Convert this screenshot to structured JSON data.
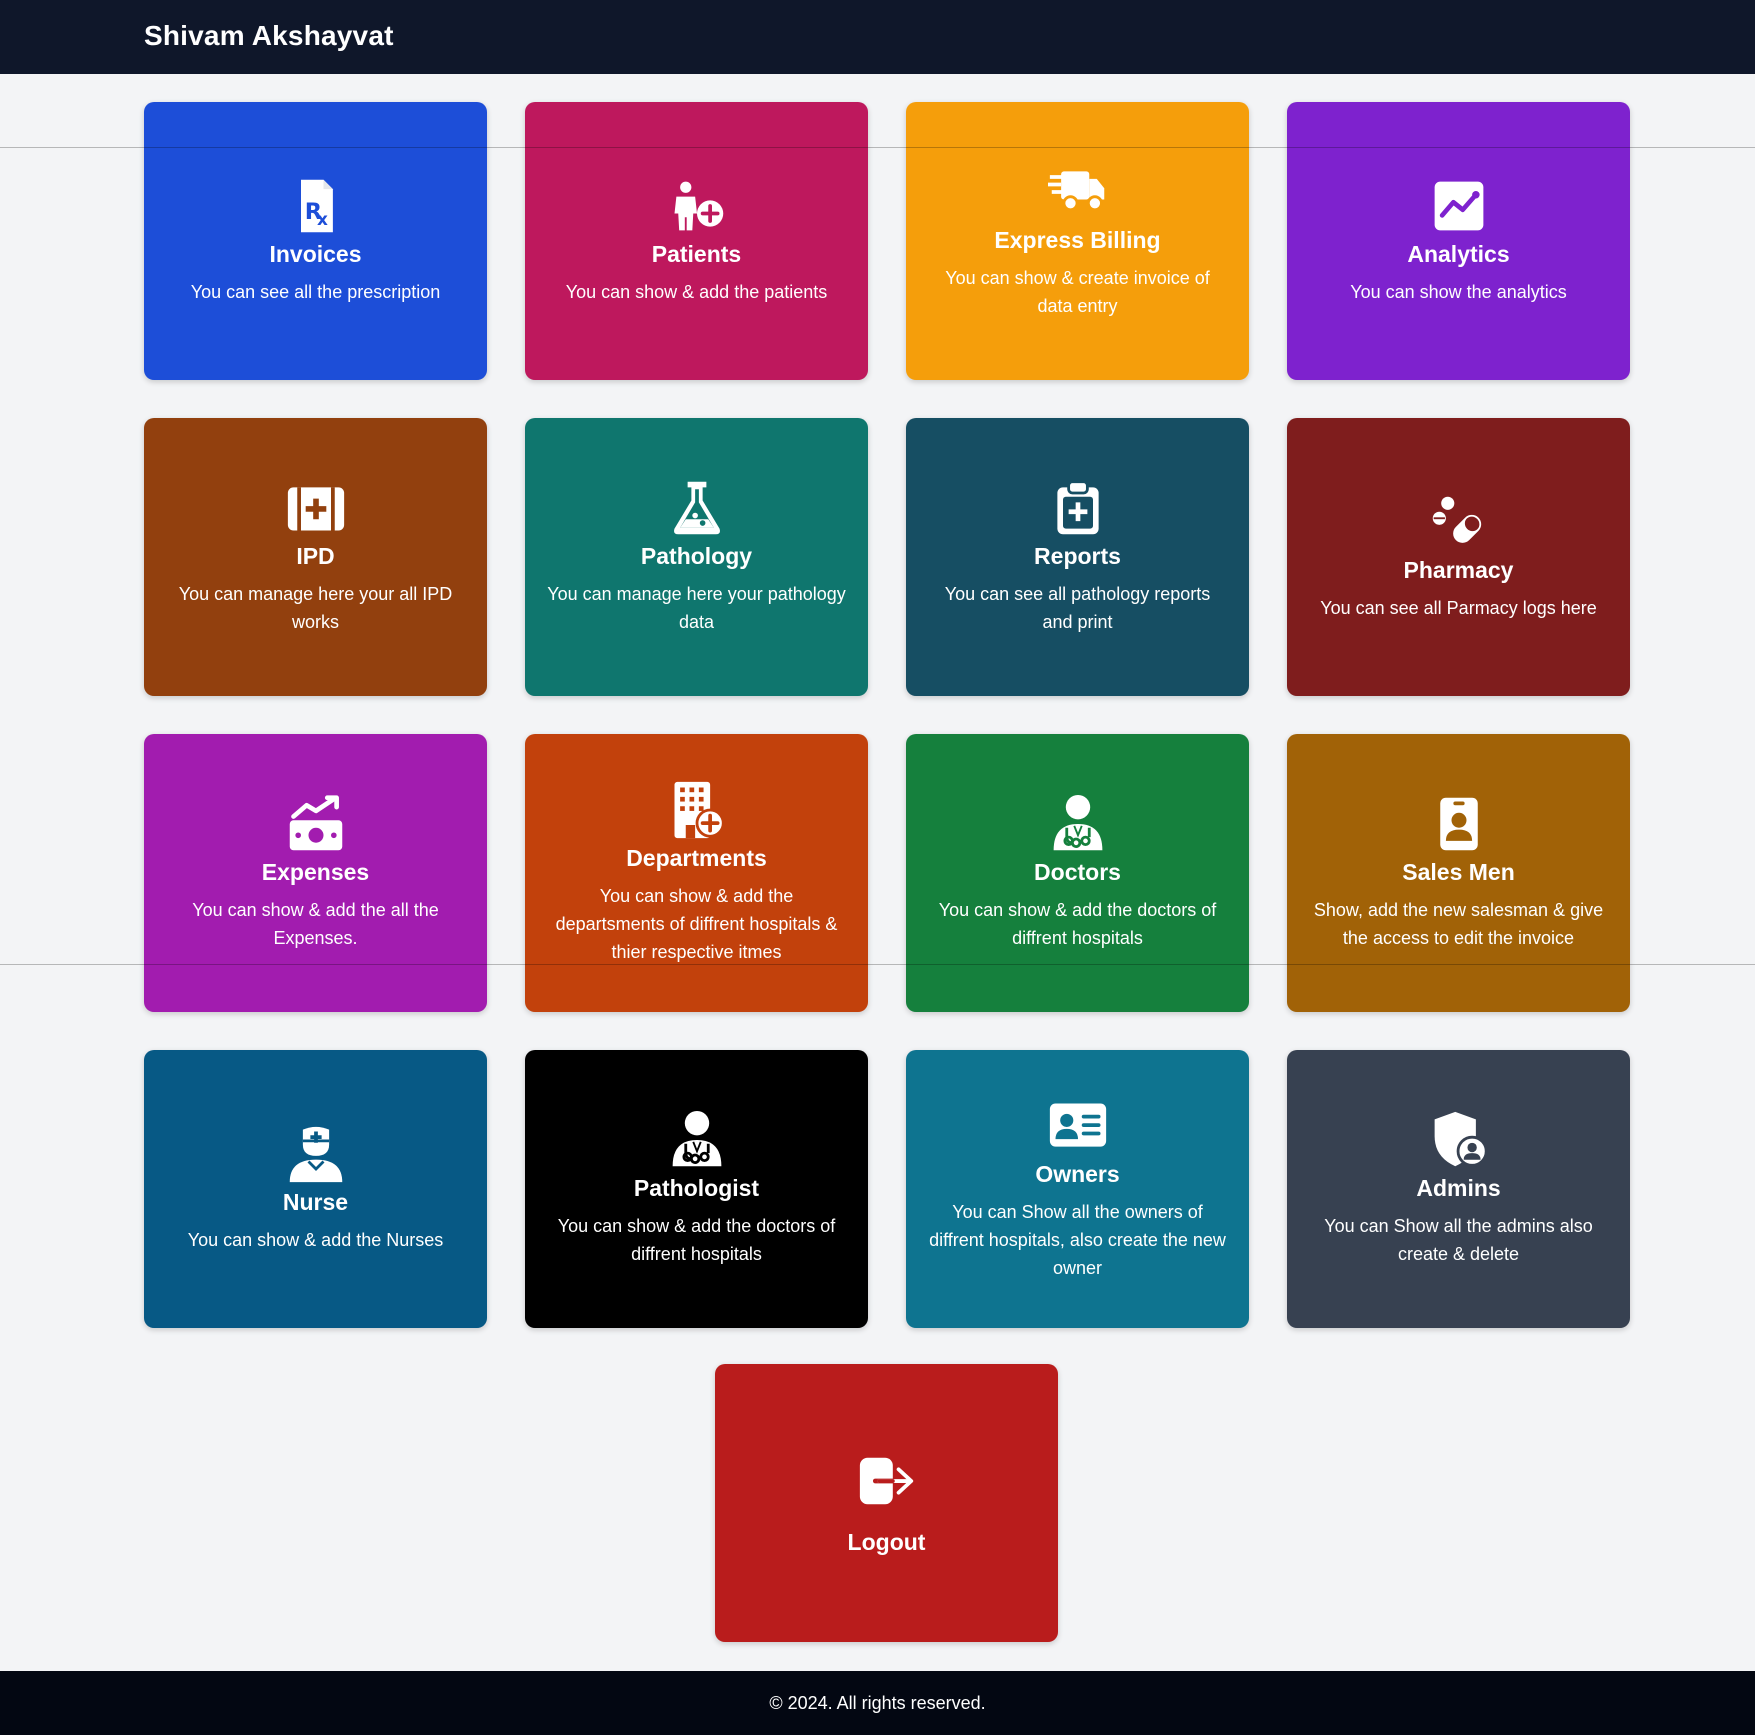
{
  "header": {
    "brand": "Shivam Akshayvat"
  },
  "cards": [
    {
      "title": "Invoices",
      "desc": "You can see all the prescription",
      "icon": "prescription-icon",
      "color": "#1d4ed8"
    },
    {
      "title": "Patients",
      "desc": "You can show & add the patients",
      "icon": "person-add-icon",
      "color": "#be185d"
    },
    {
      "title": "Express Billing",
      "desc": "You can show & create invoice of data entry",
      "icon": "truck-fast-icon",
      "color": "#f59e0b"
    },
    {
      "title": "Analytics",
      "desc": "You can show the analytics",
      "icon": "chart-line-icon",
      "color": "#7e22ce"
    },
    {
      "title": "IPD",
      "desc": "You can manage here your all IPD works",
      "icon": "medical-kit-icon",
      "color": "#92400e"
    },
    {
      "title": "Pathology",
      "desc": "You can manage here your pathology data",
      "icon": "flask-icon",
      "color": "#0f766e"
    },
    {
      "title": "Reports",
      "desc": "You can see all pathology reports and print",
      "icon": "clipboard-medical-icon",
      "color": "#164e63"
    },
    {
      "title": "Pharmacy",
      "desc": "You can see all Parmacy logs here",
      "icon": "pills-icon",
      "color": "#7f1d1d"
    },
    {
      "title": "Expenses",
      "desc": "You can show & add the all the Expenses.",
      "icon": "money-trend-icon",
      "color": "#a21caf"
    },
    {
      "title": "Departments",
      "desc": "You can show & add the departsments of diffrent hospitals & thier respective itmes",
      "icon": "hospital-building-icon",
      "color": "#c2410c"
    },
    {
      "title": "Doctors",
      "desc": "You can show & add the doctors of diffrent hospitals",
      "icon": "doctor-icon",
      "color": "#15803d"
    },
    {
      "title": "Sales Men",
      "desc": "Show, add the new salesman & give the access to edit the invoice",
      "icon": "id-badge-icon",
      "color": "#a16207"
    },
    {
      "title": "Nurse",
      "desc": "You can show & add the Nurses",
      "icon": "nurse-icon",
      "color": "#075985"
    },
    {
      "title": "Pathologist",
      "desc": "You can show & add the doctors of diffrent hospitals",
      "icon": "doctor-icon",
      "color": "#000000"
    },
    {
      "title": "Owners",
      "desc": "You can Show all the owners of diffrent hospitals, also create the new owner",
      "icon": "id-card-icon",
      "color": "#0e7490"
    },
    {
      "title": "Admins",
      "desc": "You can Show all the admins also create & delete",
      "icon": "shield-user-icon",
      "color": "#374151"
    }
  ],
  "logout": {
    "title": "Logout",
    "icon": "sign-out-icon",
    "color": "#b91c1c"
  },
  "footer": {
    "text": "© 2024. All rights reserved."
  }
}
